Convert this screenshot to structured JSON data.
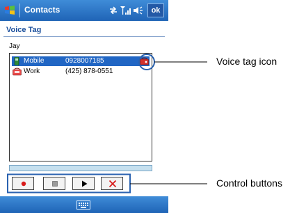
{
  "header": {
    "app_title": "Contacts",
    "ok_label": "ok"
  },
  "page": {
    "subtitle": "Voice Tag",
    "contact_name": "Jay"
  },
  "list": {
    "rows": [
      {
        "type": "Mobile",
        "number": "0928007185",
        "selected": true,
        "has_voice_tag": true
      },
      {
        "type": "Work",
        "number": "(425) 878-0551",
        "selected": false,
        "has_voice_tag": false
      }
    ]
  },
  "controls": {
    "buttons": [
      {
        "name": "record",
        "icon": "record-dot"
      },
      {
        "name": "stop",
        "icon": "stop-square"
      },
      {
        "name": "play",
        "icon": "play-triangle"
      },
      {
        "name": "delete",
        "icon": "delete-x"
      }
    ]
  },
  "annotations": {
    "voice_tag_icon": "Voice tag icon",
    "control_buttons": "Control buttons"
  },
  "colors": {
    "title_bar": "#2a72c6",
    "selection": "#2166c4",
    "callout": "#2a62b0",
    "record": "#d81b1b"
  }
}
